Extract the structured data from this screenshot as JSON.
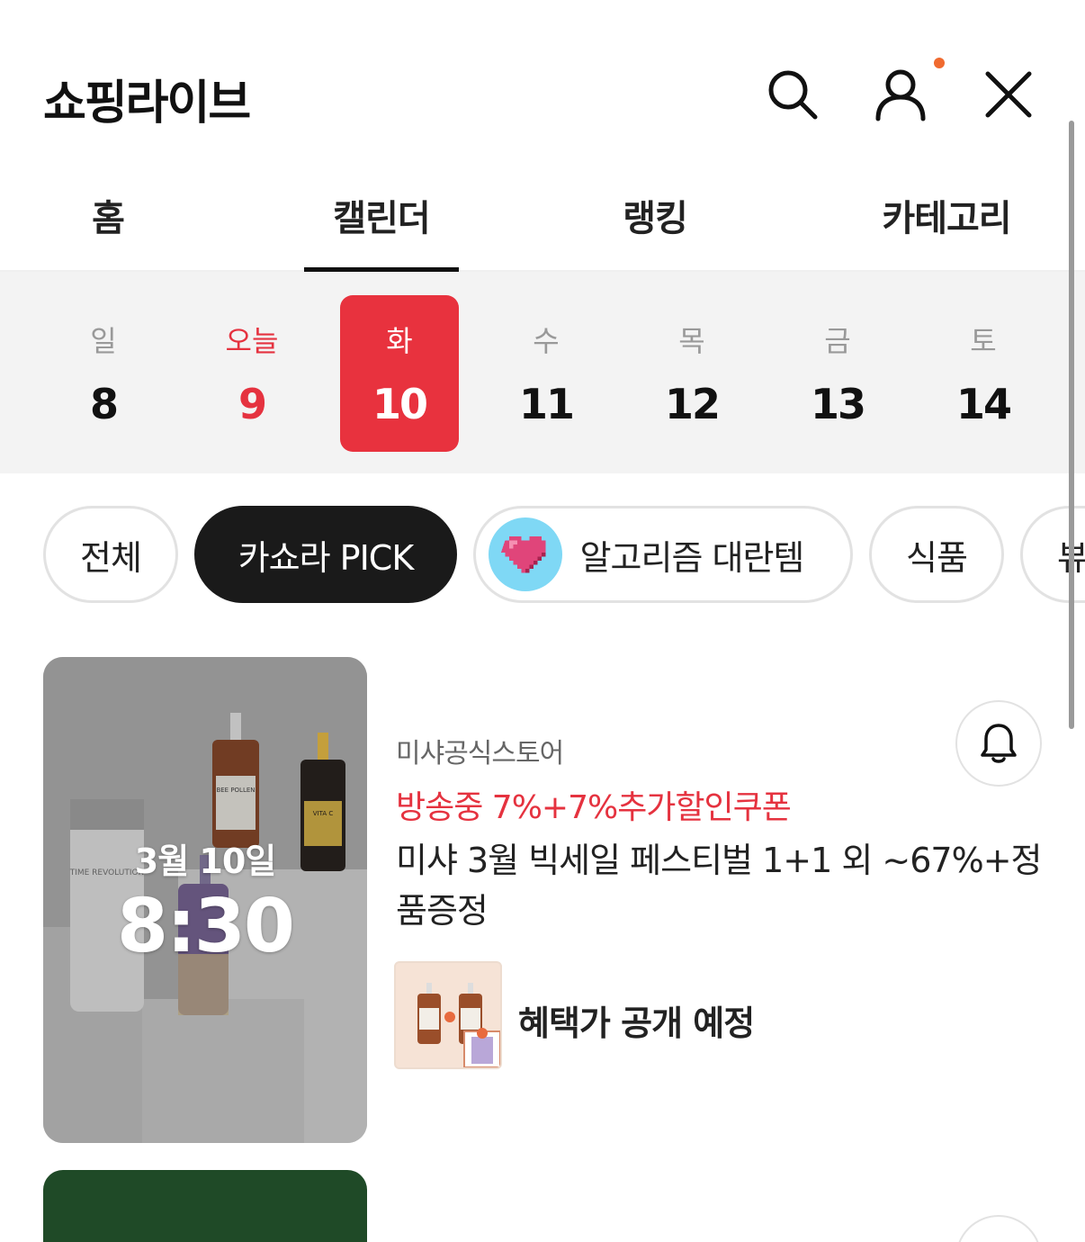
{
  "header": {
    "title": "쇼핑라이브",
    "icons": [
      "search-icon",
      "profile-icon",
      "close-icon"
    ],
    "notification_dot_color": "#f06a2f"
  },
  "tabs": [
    {
      "label": "홈",
      "active": false
    },
    {
      "label": "캘린더",
      "active": true
    },
    {
      "label": "랭킹",
      "active": false
    },
    {
      "label": "카테고리",
      "active": false
    }
  ],
  "calendar": {
    "days": [
      {
        "name": "일",
        "num": "8",
        "state": "normal"
      },
      {
        "name": "오늘",
        "num": "9",
        "state": "today"
      },
      {
        "name": "화",
        "num": "10",
        "state": "selected"
      },
      {
        "name": "수",
        "num": "11",
        "state": "normal"
      },
      {
        "name": "목",
        "num": "12",
        "state": "normal"
      },
      {
        "name": "금",
        "num": "13",
        "state": "normal"
      },
      {
        "name": "토",
        "num": "14",
        "state": "normal"
      }
    ],
    "accent_color": "#e8323e"
  },
  "filters": [
    {
      "label": "전체",
      "active": false
    },
    {
      "label": "카쇼라 PICK",
      "active": true
    },
    {
      "label": "알고리즘 대란템",
      "active": false,
      "icon": "pixel-heart-icon"
    },
    {
      "label": "식품",
      "active": false
    },
    {
      "label": "뷰",
      "active": false
    }
  ],
  "broadcast": {
    "date": "3월 10일",
    "time": "8:30",
    "store": "미샤공식스토어",
    "promo": "방송중 7%+7%추가할인쿠폰",
    "title": "미샤 3월 빅세일 페스티벌 1+1 외 ~67%+정품증정",
    "benefit": "혜택가 공개 예정",
    "product_labels": [
      "TIME REVOLUTION",
      "BEE POLLEN",
      "VITA C"
    ],
    "promo_color": "#e5323f"
  }
}
